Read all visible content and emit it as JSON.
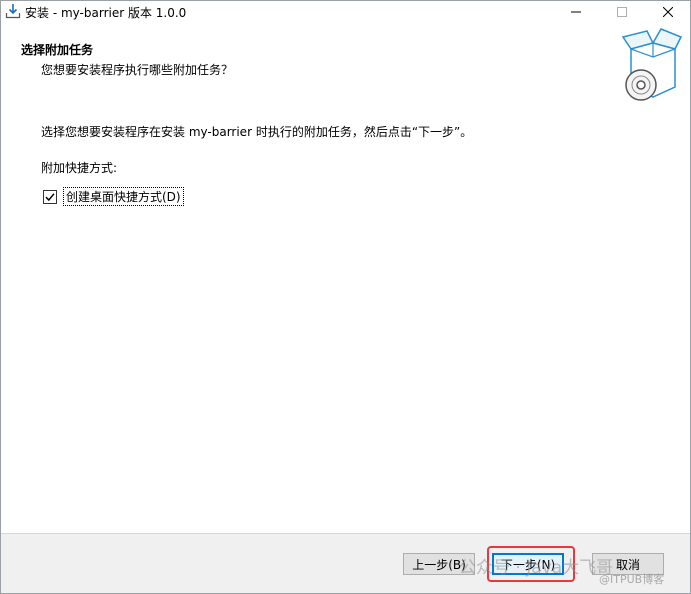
{
  "window": {
    "title": "安装 - my-barrier 版本 1.0.0"
  },
  "header": {
    "title": "选择附加任务",
    "subtitle": "您想要安装程序执行哪些附加任务？"
  },
  "content": {
    "description": "选择您想要安装程序在安装 my-barrier 时执行的附加任务，然后点击“下一步”。",
    "group_label": "附加快捷方式:",
    "checkbox": {
      "label": "创建桌面快捷方式(D)",
      "checked": true
    }
  },
  "footer": {
    "back_label": "上一步(B)",
    "next_label": "下一步(N)",
    "cancel_label": "取消"
  },
  "watermark": {
    "line1": "公众号 · Java大飞哥",
    "line2": "@ITPUB博客"
  },
  "colors": {
    "highlight": "#e8393d",
    "next_button_border": "#0078d7",
    "footer_bg": "#f0f0f0"
  }
}
